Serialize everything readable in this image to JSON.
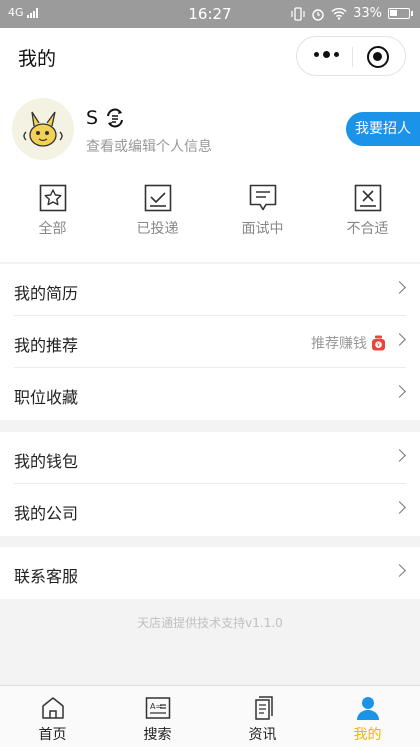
{
  "status_bar": {
    "network": "4G",
    "time": "16:27",
    "battery": "33%"
  },
  "header": {
    "title": "我的"
  },
  "profile": {
    "name": "S",
    "hint": "查看或编辑个人信息",
    "recruit_label": "我要招人"
  },
  "application_tabs": [
    {
      "label": "全部",
      "icon": "star-box-icon"
    },
    {
      "label": "已投递",
      "icon": "check-box-icon"
    },
    {
      "label": "面试中",
      "icon": "chat-box-icon"
    },
    {
      "label": "不合适",
      "icon": "cross-box-icon"
    }
  ],
  "menu_groups": [
    [
      {
        "label": "我的简历"
      },
      {
        "label": "我的推荐",
        "extra": "推荐赚钱"
      },
      {
        "label": "职位收藏"
      }
    ],
    [
      {
        "label": "我的钱包"
      },
      {
        "label": "我的公司"
      }
    ],
    [
      {
        "label": "联系客服"
      }
    ]
  ],
  "footer_note": "天店通提供技术支持v1.1.0",
  "bottom_nav": [
    {
      "label": "首页",
      "icon": "home-icon",
      "active": false
    },
    {
      "label": "搜索",
      "icon": "id-card-icon",
      "active": false
    },
    {
      "label": "资讯",
      "icon": "document-icon",
      "active": false
    },
    {
      "label": "我的",
      "icon": "user-icon",
      "active": true
    }
  ],
  "colors": {
    "accent_blue": "#1a93e8",
    "active_tab": "#f3b400",
    "badge_red": "#e8453c"
  }
}
